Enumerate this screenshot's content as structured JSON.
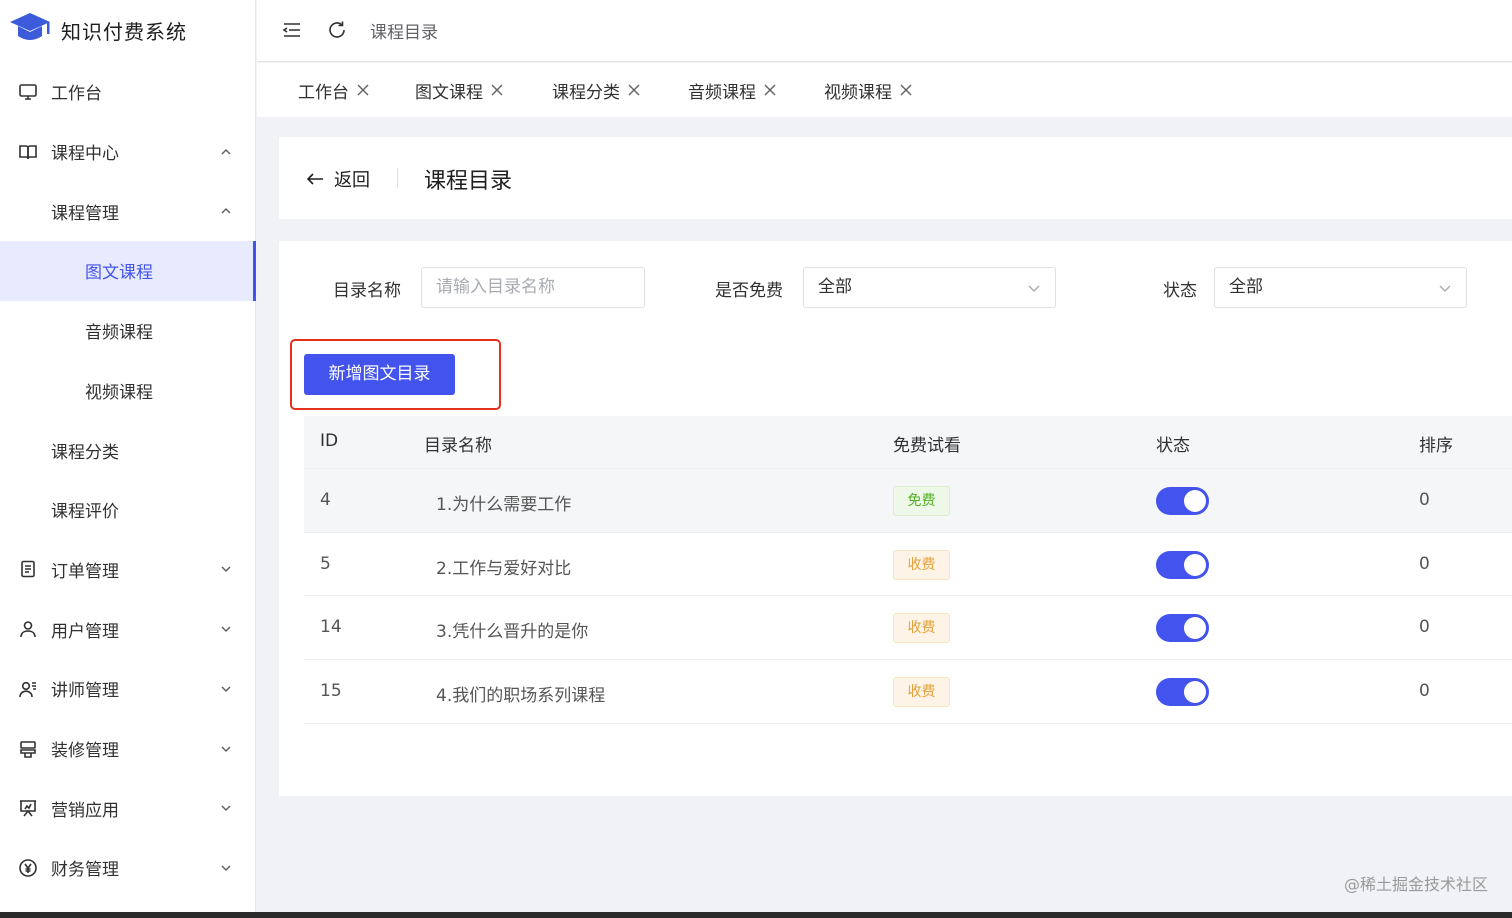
{
  "app": {
    "name": "知识付费系统"
  },
  "colors": {
    "primary": "#4253ee",
    "highlight_border": "#e5311c",
    "free_tag": "#52b026",
    "paid_tag": "#e6a23c"
  },
  "sidebar": {
    "items": [
      {
        "label": "工作台",
        "icon": "monitor-icon",
        "level": 1
      },
      {
        "label": "课程中心",
        "icon": "book-icon",
        "level": 1,
        "expanded": true
      },
      {
        "label": "课程管理",
        "level": 2,
        "expanded": true
      },
      {
        "label": "图文课程",
        "level": 3,
        "active": true
      },
      {
        "label": "音频课程",
        "level": 3
      },
      {
        "label": "视频课程",
        "level": 3
      },
      {
        "label": "课程分类",
        "level": 2
      },
      {
        "label": "课程评价",
        "level": 2
      },
      {
        "label": "订单管理",
        "icon": "order-icon",
        "level": 1
      },
      {
        "label": "用户管理",
        "icon": "user-icon",
        "level": 1
      },
      {
        "label": "讲师管理",
        "icon": "teacher-icon",
        "level": 1
      },
      {
        "label": "装修管理",
        "icon": "decorate-icon",
        "level": 1
      },
      {
        "label": "营销应用",
        "icon": "marketing-icon",
        "level": 1
      },
      {
        "label": "财务管理",
        "icon": "finance-icon",
        "level": 1
      }
    ]
  },
  "header": {
    "breadcrumb": "课程目录"
  },
  "tabs": [
    {
      "label": "工作台"
    },
    {
      "label": "图文课程"
    },
    {
      "label": "课程分类"
    },
    {
      "label": "音频课程"
    },
    {
      "label": "视频课程"
    }
  ],
  "page": {
    "back_label": "返回",
    "title": "课程目录"
  },
  "filters": {
    "name_label": "目录名称",
    "name_placeholder": "请输入目录名称",
    "free_label": "是否免费",
    "free_value": "全部",
    "status_label": "状态",
    "status_value": "全部"
  },
  "actions": {
    "add_label": "新增图文目录"
  },
  "table": {
    "columns": [
      "ID",
      "目录名称",
      "免费试看",
      "状态",
      "排序"
    ],
    "rows": [
      {
        "id": "4",
        "name": "1.为什么需要工作",
        "free": "免费",
        "free_type": "free",
        "status_on": true,
        "sort": "0"
      },
      {
        "id": "5",
        "name": "2.工作与爱好对比",
        "free": "收费",
        "free_type": "paid",
        "status_on": true,
        "sort": "0"
      },
      {
        "id": "14",
        "name": "3.凭什么晋升的是你",
        "free": "收费",
        "free_type": "paid",
        "status_on": true,
        "sort": "0"
      },
      {
        "id": "15",
        "name": "4.我们的职场系列课程",
        "free": "收费",
        "free_type": "paid",
        "status_on": true,
        "sort": "0"
      }
    ]
  },
  "watermark": "@稀土掘金技术社区"
}
